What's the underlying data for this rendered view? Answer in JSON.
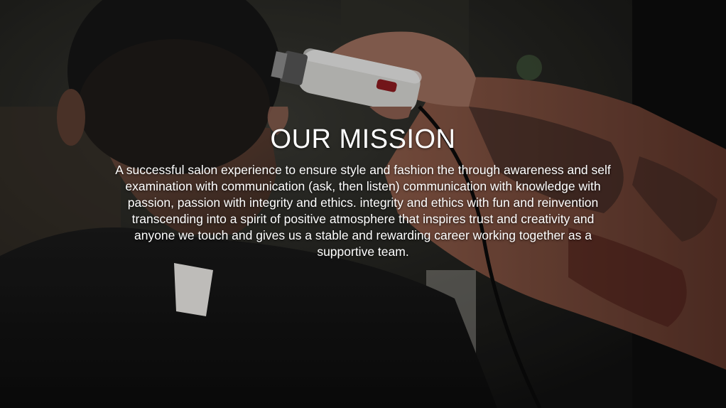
{
  "mission": {
    "title": "OUR MISSION",
    "body": "A successful salon experience to ensure style and fashion the through awareness and self examination with communication (ask, then listen) communication with knowledge with passion, passion with integrity and ethics. integrity and ethics with fun and reinvention transcending into a spirit of positive atmosphere that inspires trust and creativity and anyone we touch and gives us a  stable and rewarding career working together as a supportive team."
  },
  "colors": {
    "text": "#ffffff",
    "background": "#1a1a1a"
  }
}
